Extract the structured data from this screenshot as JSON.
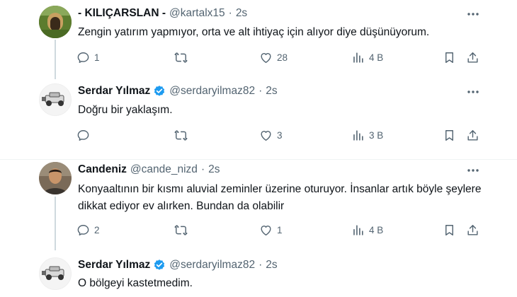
{
  "colors": {
    "text": "#0f1419",
    "muted": "#536471",
    "verified": "#1d9bf0",
    "divider": "#eff3f4"
  },
  "tweets": [
    {
      "name": "- KILIÇARSLAN -",
      "handle": "@kartalx15",
      "time": "2s",
      "verified": false,
      "text": "Zengin yatırım yapmıyor, orta ve alt ihtiyaç için alıyor diye düşünüyorum.",
      "replies": "1",
      "retweets": "",
      "likes": "28",
      "views": "4 B"
    },
    {
      "name": "Serdar Yılmaz",
      "handle": "@serdaryilmaz82",
      "time": "2s",
      "verified": true,
      "text": "Doğru bir yaklaşım.",
      "replies": "",
      "retweets": "",
      "likes": "3",
      "views": "3 B"
    },
    {
      "name": "Candeniz",
      "handle": "@cande_nizd",
      "time": "2s",
      "verified": false,
      "text": "Konyaaltının bir kısmı aluvial zeminler üzerine oturuyor. İnsanlar artık böyle şeylere dikkat ediyor ev alırken. Bundan da olabilir",
      "replies": "2",
      "retweets": "",
      "likes": "1",
      "views": "4 B"
    },
    {
      "name": "Serdar Yılmaz",
      "handle": "@serdaryilmaz82",
      "time": "2s",
      "verified": true,
      "text": "O bölgeyi kastetmedim."
    }
  ]
}
